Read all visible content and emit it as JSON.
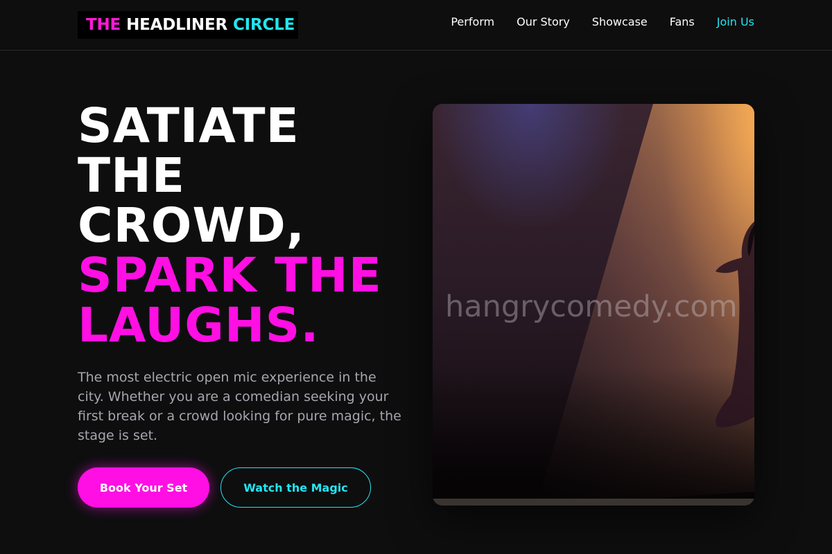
{
  "brand": {
    "word1": "THE",
    "word2": "HEADLINER",
    "word3": "CIRCLE"
  },
  "nav": {
    "items": [
      {
        "label": "Perform"
      },
      {
        "label": "Our Story"
      },
      {
        "label": "Showcase"
      },
      {
        "label": "Fans"
      },
      {
        "label": "Join Us"
      }
    ]
  },
  "hero": {
    "title_white": [
      "SATIATE",
      "THE",
      "CROWD,"
    ],
    "title_pink": [
      "SPARK THE",
      "LAUGHS."
    ],
    "description": "The most electric open mic experience in the city. Whether you are a comedian seeking your first break or a crowd looking for pure magic, the stage is set.",
    "primary_button": "Book Your Set",
    "secondary_button": "Watch the Magic"
  },
  "photo": {
    "watermark": "hangrycomedy.com"
  },
  "colors": {
    "accent_pink": "#ff0fe3",
    "accent_cyan": "#22e6f0",
    "background": "#0e0e0f"
  }
}
